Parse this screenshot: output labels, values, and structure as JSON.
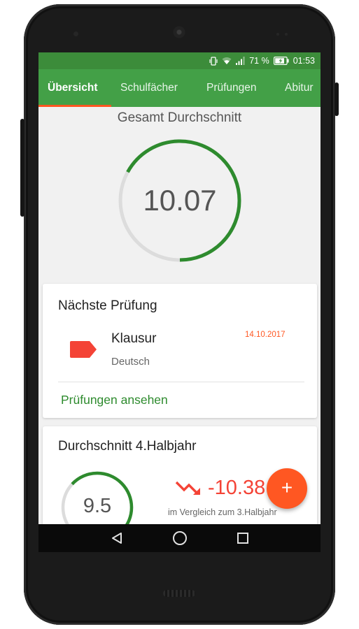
{
  "status_bar": {
    "battery_percent": "71 %",
    "time": "01:53",
    "icons": [
      "vibrate-icon",
      "wifi-icon",
      "signal-icon",
      "battery-charging-icon"
    ]
  },
  "tabs": [
    {
      "label": "Übersicht",
      "active": true
    },
    {
      "label": "Schulfächer",
      "active": false
    },
    {
      "label": "Prüfungen",
      "active": false
    },
    {
      "label": "Abitur",
      "active": false
    }
  ],
  "overall": {
    "title": "Gesamt Durchschnitt",
    "value": "10.07",
    "progress_fraction": 0.67,
    "color": "#2e8b2e"
  },
  "next_exam": {
    "title": "Nächste Prüfung",
    "type": "Klausur",
    "subject": "Deutsch",
    "date": "14.10.2017",
    "tag_color": "#f44336",
    "view_label": "Prüfungen ansehen"
  },
  "semester": {
    "title": "Durchschnitt 4.Halbjahr",
    "value": "9.5",
    "progress_fraction": 0.63,
    "trend_icon": "trending-down-icon",
    "trend_value": "-10.38",
    "trend_caption": "im Vergleich zum 3.Halbjahr"
  },
  "fab": {
    "label": "+",
    "icon": "add-icon",
    "color": "#ff5722"
  },
  "nav": {
    "icons": [
      "back-icon",
      "home-icon",
      "recents-icon"
    ]
  },
  "colors": {
    "primary": "#43a047",
    "primary_dark": "#3c8c3a",
    "accent": "#ff5722",
    "negative": "#f44336"
  }
}
